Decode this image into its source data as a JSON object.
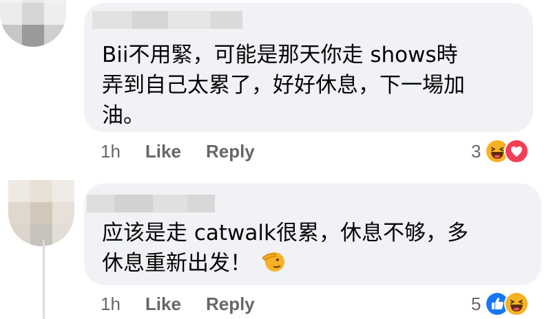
{
  "comments": [
    {
      "text_lines": [
        "Bii不用緊，可能是那天你走 shows時",
        "弄到自己太累了，好好休息，下一場加",
        "油。"
      ],
      "time": "1h",
      "like_label": "Like",
      "reply_label": "Reply",
      "reaction_count": "3",
      "reactions": [
        "haha-icon",
        "love-icon"
      ]
    },
    {
      "text_lines": [
        "应该是走 catwalk很累，休息不够，多",
        "休息重新出发！"
      ],
      "inline_emoji": "saluting-face-icon",
      "time": "1h",
      "like_label": "Like",
      "reply_label": "Reply",
      "reaction_count": "5",
      "reactions": [
        "like-icon",
        "haha-icon"
      ]
    }
  ],
  "colors": {
    "bubble": "#f0f2f5",
    "text": "#050505",
    "meta": "#65676b",
    "like_blue": "#1877f2",
    "love_red": "#f33e58",
    "haha_yellow": "#f7b125"
  }
}
